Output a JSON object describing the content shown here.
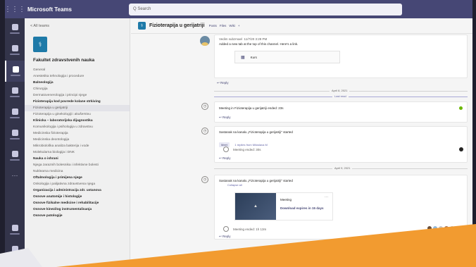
{
  "window": {
    "app_title": "Microsoft Teams",
    "search_placeholder": "Q Search"
  },
  "sidebar": {
    "back_label": "< All teams",
    "team_name": "Fakultet zdravstvenih nauka",
    "channels": [
      {
        "label": "General",
        "bold": false,
        "active": false
      },
      {
        "label": "Anestetika tehnologija i procedure",
        "bold": false,
        "active": false
      },
      {
        "label": "Balneologija",
        "bold": true,
        "active": false
      },
      {
        "label": "Chirurgija",
        "bold": false,
        "active": false
      },
      {
        "label": "Dermatovenerologija i principi njege",
        "bold": false,
        "active": false
      },
      {
        "label": "Fizioterapija kod povrede kolane strkiving",
        "bold": true,
        "active": false
      },
      {
        "label": "Fizioterapija u gerijatriji",
        "bold": false,
        "active": true
      },
      {
        "label": "Fizioterapija u ginekologiji i akušerstvu",
        "bold": false,
        "active": false
      },
      {
        "label": "Klinicka – laboratorijska dijagnostika",
        "bold": true,
        "active": false
      },
      {
        "label": "Komunikologija i psihologija u zdravstvu",
        "bold": false,
        "active": false
      },
      {
        "label": "Medicinska fizioterapija",
        "bold": false,
        "active": false
      },
      {
        "label": "Medicinska deontologija",
        "bold": false,
        "active": false
      },
      {
        "label": "Mikrobiološka analiza bakterija i vode",
        "bold": false,
        "active": false
      },
      {
        "label": "Molekularna biologija i DNK",
        "bold": false,
        "active": false
      },
      {
        "label": "Nauka o ishrani",
        "bold": true,
        "active": false
      },
      {
        "label": "Njega zaraznih bolesnika i infektivne bolesti",
        "bold": false,
        "active": false
      },
      {
        "label": "Nuklearna medicina",
        "bold": false,
        "active": false
      },
      {
        "label": "Oftalmologija i primijena njege",
        "bold": true,
        "active": false
      },
      {
        "label": "Onkologija i palijativna zdravstvena njega",
        "bold": false,
        "active": false
      },
      {
        "label": "Organizacija i administracija zdr. ustanova",
        "bold": true,
        "active": false
      },
      {
        "label": "Osnove anatomije i histologije",
        "bold": true,
        "active": false
      },
      {
        "label": "Osnove fizikalne medicine i rehabilitacije",
        "bold": true,
        "active": false
      },
      {
        "label": "Osnove kinezilog instrumentalisanja",
        "bold": true,
        "active": false
      },
      {
        "label": "Osnove patologije",
        "bold": true,
        "active": false
      }
    ]
  },
  "channel_header": {
    "title": "Fizioterapija u gerijatriji",
    "tabs": [
      "Posts",
      "Files",
      "Wiki",
      "+"
    ]
  },
  "messages": {
    "post1": {
      "author": "Vedim subzmael",
      "time": "11/7/20 3:29 PM",
      "body": "Added a new tab at the top of this channel. Here's a link.",
      "attachment": "Kurs",
      "reply": "↩ Reply"
    },
    "date1": "April 8, 2021",
    "last_read": "Last read",
    "post2": {
      "body": "Meeting in Fizioterapija u gerijatriji ended: 23s",
      "reply": "↩ Reply"
    },
    "post3": {
      "body": "Sastanak na kanalu „Fizioterapija u gerijatriji\" started",
      "tag": "Meet",
      "link": "1 replies from Miloslava M",
      "meeting_ended": "Meeting ended: 30s",
      "reply": "↩ Reply"
    },
    "date2": "April 9, 2021",
    "post4": {
      "body": "Sastanak na kanalu „Fizioterapija u gerijatriji\" started",
      "sub": "Collapse all",
      "recording_title": "Meeting",
      "recording_download": "Download  expires in 15 days",
      "recording_more": "···",
      "meeting_ended": "Meeting ended: 1h 13m",
      "reply": "↩ Reply"
    }
  },
  "colors": {
    "brand": "#464775",
    "rail": "#33344a",
    "accent": "#6264a7",
    "overlay": "#f29b30"
  },
  "icons": [
    "grid-icon",
    "activity-icon",
    "chat-icon",
    "teams-icon",
    "assignments-icon",
    "calendar-icon",
    "calls-icon",
    "files-icon",
    "more-icon",
    "apps-icon",
    "help-icon"
  ]
}
